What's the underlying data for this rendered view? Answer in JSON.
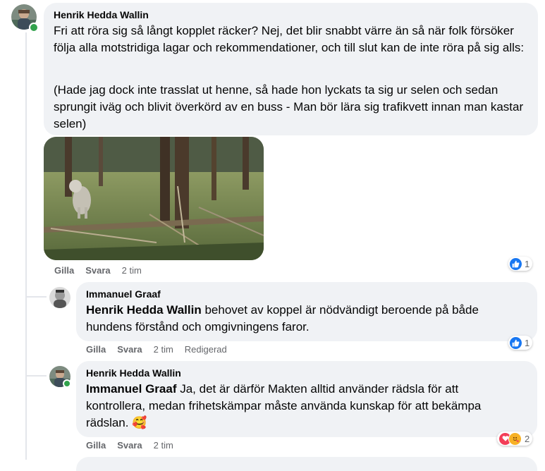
{
  "comments": [
    {
      "author": "Henrik Hedda Wallin",
      "paragraph1": "Fri att röra sig så långt kopplet räcker? Nej, det blir snabbt värre än så när folk försöker följa alla motstridiga lagar och rekommendationer, och till slut kan de inte röra på sig alls:",
      "paragraph2": "(Hade jag dock inte trasslat ut henne, så hade hon lyckats ta sig ur selen och sedan sprungit iväg och blivit överkörd av en buss - Man bör lära sig trafikvett innan man kastar selen)",
      "like": "Gilla",
      "reply": "Svara",
      "time": "2 tim",
      "reaction_count": "1",
      "reaction_icon": "like-icon"
    },
    {
      "author": "Immanuel Graaf",
      "mention": "Henrik Hedda Wallin",
      "text": " behovet av koppel är nödvändigt beroende på både hundens förstånd och omgivningens faror.",
      "like": "Gilla",
      "reply": "Svara",
      "time": "2 tim",
      "edited": "Redigerad",
      "reaction_count": "1",
      "reaction_icon": "like-icon"
    },
    {
      "author": "Henrik Hedda Wallin",
      "mention": "Immanuel Graaf",
      "text": " Ja, det är därför Makten alltid använder rädsla för att kontrollera, medan frihetskämpar måste använda kunskap för att bekämpa rädslan. ",
      "emoji": "🥰",
      "like": "Gilla",
      "reply": "Svara",
      "time": "2 tim",
      "reaction_count": "2",
      "reaction_icons": [
        "love-icon",
        "care-icon"
      ]
    }
  ],
  "colors": {
    "bubble": "#f0f2f5",
    "meta": "#65676b",
    "like_blue": "#1877f2",
    "love_red": "#f33e58",
    "care_yellow": "#f7b125",
    "online_green": "#31a24c"
  }
}
